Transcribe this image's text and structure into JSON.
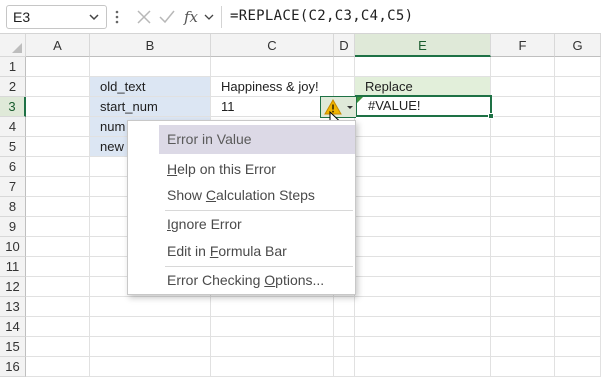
{
  "formula_bar": {
    "name_box": "E3",
    "formula": "=REPLACE(C2,C3,C4,C5)",
    "icons": [
      "chevron-down-icon",
      "more-vertical-icon",
      "cancel-x-icon",
      "check-icon",
      "fx-icon",
      "chevron-down-icon"
    ]
  },
  "columns": [
    "A",
    "B",
    "C",
    "D",
    "E",
    "F",
    "G"
  ],
  "selected_column": "E",
  "rows": [
    "1",
    "2",
    "3",
    "4",
    "5",
    "6",
    "7",
    "8",
    "9",
    "10",
    "11",
    "12",
    "13",
    "14",
    "15",
    "16"
  ],
  "selected_row": "3",
  "cells": {
    "B2": "old_text",
    "B3": "start_num",
    "B4": "num",
    "B5": "new",
    "C2": "Happiness & joy!",
    "C3": "11",
    "E2": "Replace",
    "E3": "#VALUE!"
  },
  "error_menu": {
    "title": "Error in Value",
    "items": [
      {
        "pre": "",
        "u": "H",
        "post": "elp on this Error"
      },
      {
        "pre": "Show ",
        "u": "C",
        "post": "alculation Steps"
      },
      {
        "pre": "",
        "u": "I",
        "post": "gnore Error"
      },
      {
        "pre": "Edit in ",
        "u": "F",
        "post": "ormula Bar"
      },
      {
        "pre": "Error Checking ",
        "u": "O",
        "post": "ptions..."
      }
    ]
  },
  "colors": {
    "accent": "#1e7145",
    "input_fill": "#dce6f3",
    "output_fill": "#e2efda",
    "warning": "#f0b400"
  }
}
